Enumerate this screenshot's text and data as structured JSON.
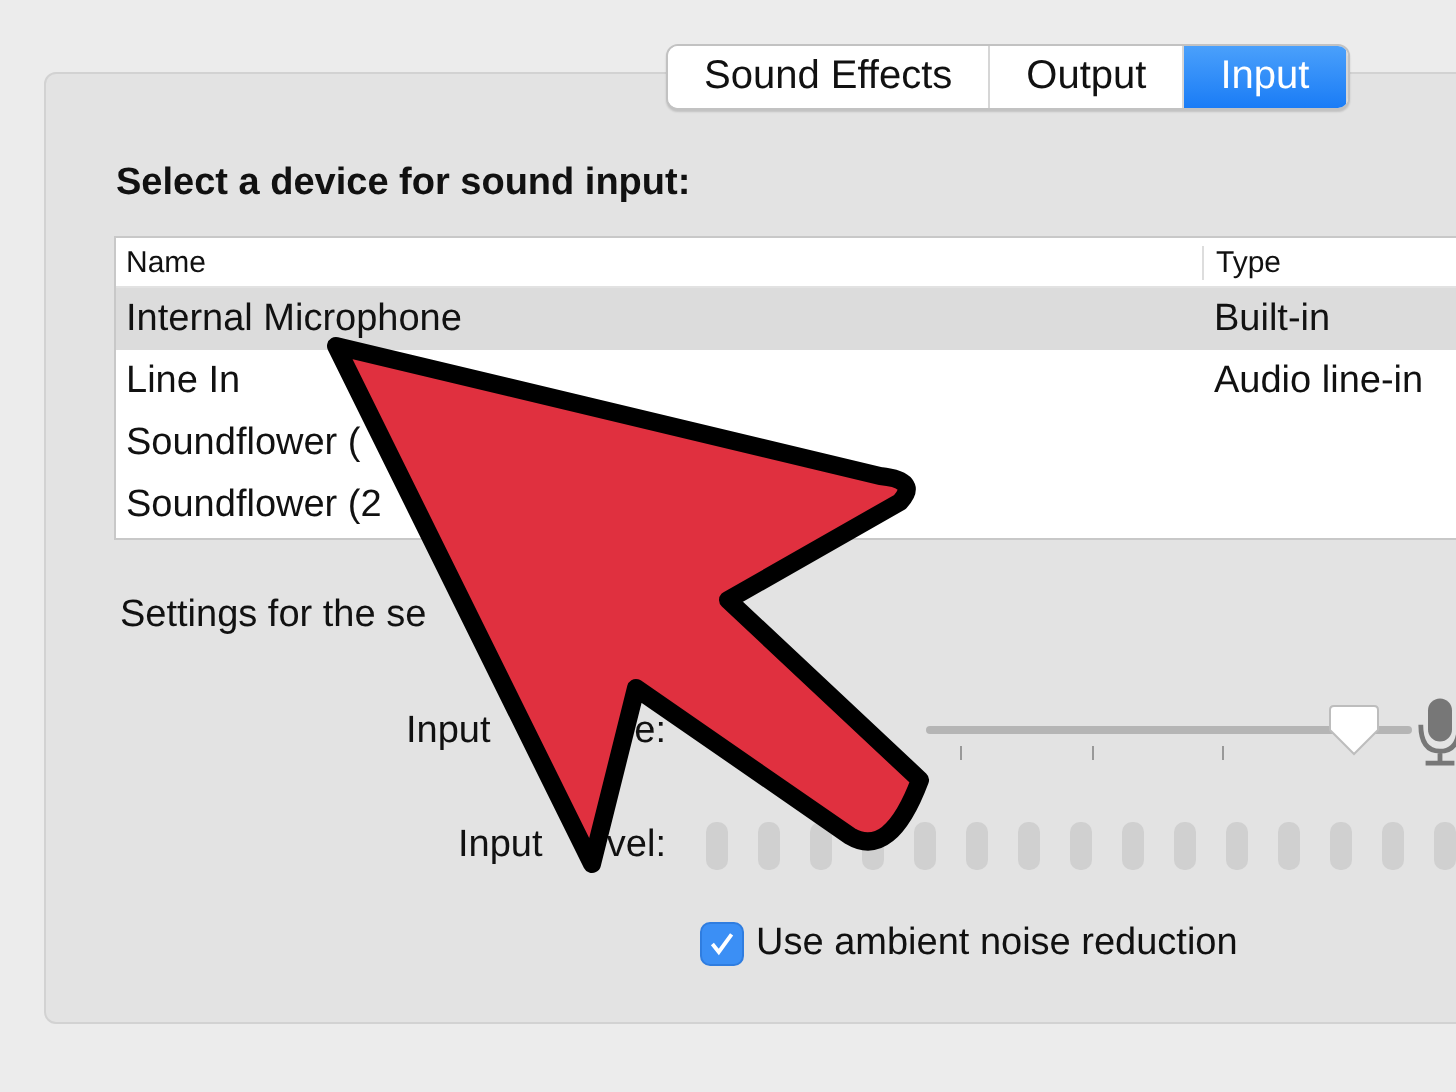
{
  "tabs": [
    {
      "label": "Sound Effects",
      "selected": false
    },
    {
      "label": "Output",
      "selected": false
    },
    {
      "label": "Input",
      "selected": true
    }
  ],
  "device_heading": "Select a device for sound input:",
  "table": {
    "columns": [
      "Name",
      "Type"
    ],
    "rows": [
      {
        "name": "Internal Microphone",
        "type": "Built-in",
        "selected": true
      },
      {
        "name": "Line In",
        "type": "Audio line-in",
        "selected": false
      },
      {
        "name": "Soundflower (",
        "selected": false
      },
      {
        "name": "Soundflower (2",
        "selected": false
      }
    ]
  },
  "settings_heading": "Settings for the se",
  "input_volume": {
    "label_start": "Input",
    "label_end": "e:",
    "level": 0.88
  },
  "input_level": {
    "label_start": "Input",
    "label_end": "vel:"
  },
  "noise_reduction": {
    "label": "Use ambient noise reduction",
    "checked": true
  }
}
